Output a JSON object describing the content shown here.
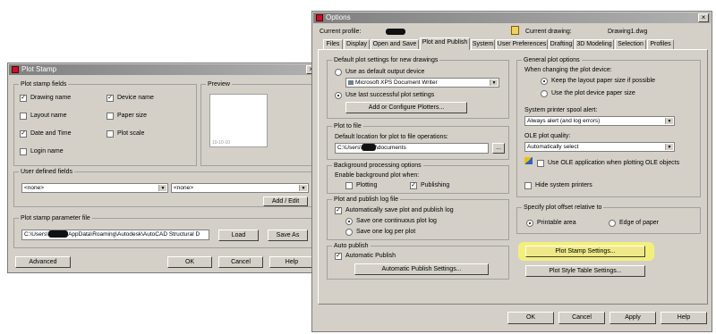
{
  "plot_stamp": {
    "title": "Plot Stamp",
    "fields_label": "Plot stamp fields",
    "fields": {
      "drawing_name": "Drawing name",
      "device_name": "Device name",
      "layout_name": "Layout name",
      "paper_size": "Paper size",
      "date_time": "Date and Time",
      "plot_scale": "Plot scale",
      "login_name": "Login name"
    },
    "preview_label": "Preview",
    "preview_text": "10-10-10",
    "user_defined_label": "User defined fields",
    "user_field_1": "<none>",
    "user_field_2": "<none>",
    "add_edit": "Add / Edit",
    "param_file_label": "Plot stamp parameter file",
    "param_file_prefix": "C:\\Users\\",
    "param_file_rest": "AppData\\Roaming\\Autodesk\\AutoCAD Structural D",
    "load": "Load",
    "save_as": "Save As",
    "advanced": "Advanced",
    "ok": "OK",
    "cancel": "Cancel",
    "help": "Help"
  },
  "options": {
    "title": "Options",
    "current_profile_label": "Current profile:",
    "current_drawing_label": "Current drawing:",
    "current_drawing": "Drawing1.dwg",
    "tabs": [
      "Files",
      "Display",
      "Open and Save",
      "Plot and Publish",
      "System",
      "User Preferences",
      "Drafting",
      "3D Modeling",
      "Selection",
      "Profiles"
    ],
    "default_settings_label": "Default plot settings for new drawings",
    "use_default_device": "Use as default output device",
    "device_value": "Microsoft XPS Document Writer",
    "use_last_successful": "Use last successful plot settings",
    "add_configure_plotters": "Add or Configure Plotters...",
    "plot_to_file_label": "Plot to file",
    "default_location": "Default location for plot to file operations:",
    "location_prefix": "C:\\Users\\",
    "location_rest": "\\documents",
    "browse": "...",
    "background_label": "Background processing options",
    "enable_background": "Enable background plot when:",
    "plotting": "Plotting",
    "publishing": "Publishing",
    "log_label": "Plot and publish log file",
    "auto_save_log": "Automatically save plot and publish log",
    "save_continuous": "Save one continuous plot log",
    "save_per_plot": "Save one log per plot",
    "auto_publish_label": "Auto publish",
    "automatic_publish": "Automatic Publish",
    "auto_publish_settings": "Automatic Publish Settings...",
    "general_label": "General plot options",
    "when_changing": "When changing the plot device:",
    "keep_layout_paper": "Keep the layout paper size if possible",
    "use_device_paper": "Use the plot device paper size",
    "spool_alert_label": "System printer spool alert:",
    "spool_alert_value": "Always alert (and log errors)",
    "ole_quality_label": "OLE plot quality:",
    "ole_quality_value": "Automatically select",
    "use_ole_app": "Use OLE application when plotting OLE objects",
    "hide_system_printers": "Hide system printers",
    "offset_label": "Specify plot offset relative to",
    "printable_area": "Printable area",
    "edge_of_paper": "Edge of paper",
    "plot_stamp_settings": "Plot Stamp Settings...",
    "plot_style_table_settings": "Plot Style Table Settings...",
    "ok": "OK",
    "cancel": "Cancel",
    "apply": "Apply",
    "help": "Help"
  },
  "colors": {
    "dialog_bg": "#d4d0c8",
    "highlight": "#f3f07a"
  }
}
